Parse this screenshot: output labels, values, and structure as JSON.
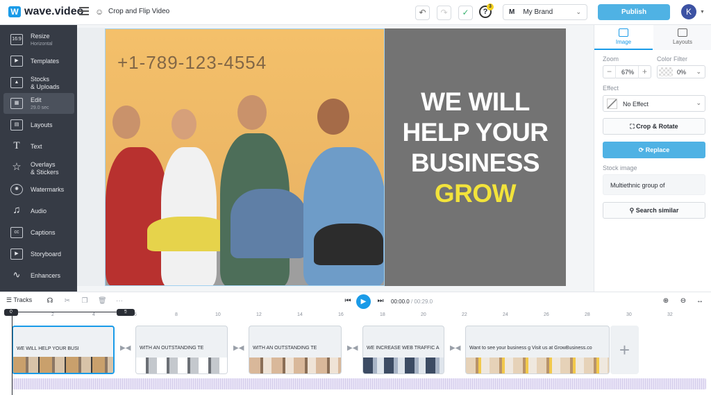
{
  "app": {
    "logo": "wave.video",
    "project_title": "Crop and Flip Video"
  },
  "header": {
    "help_badge": "3",
    "brand_initial": "M",
    "brand_name": "My Brand",
    "publish_label": "Publish",
    "avatar_initial": "K"
  },
  "sidebar": {
    "items": [
      {
        "label": "Resize",
        "sub": "Horizontal",
        "icon_text": "16:9"
      },
      {
        "label": "Templates"
      },
      {
        "label": "Stocks",
        "label2": "& Uploads"
      },
      {
        "label": "Edit",
        "sub": "29.0 sec"
      },
      {
        "label": "Layouts"
      },
      {
        "label": "Text"
      },
      {
        "label": "Overlays",
        "label2": "& Stickers"
      },
      {
        "label": "Watermarks"
      },
      {
        "label": "Audio"
      },
      {
        "label": "Captions"
      },
      {
        "label": "Storyboard"
      },
      {
        "label": "Enhancers"
      }
    ]
  },
  "canvas": {
    "phone_text": "+1-789-123-4554",
    "headline_lines": [
      "WE WILL",
      "HELP YOUR",
      "BUSINESS"
    ],
    "headline_accent": "GROW",
    "accent_color": "#f2e33b"
  },
  "right_panel": {
    "tab_image": "Image",
    "tab_layouts": "Layouts",
    "zoom_label": "Zoom",
    "zoom_value": "67%",
    "color_filter_label": "Color Filter",
    "color_filter_value": "0%",
    "effect_label": "Effect",
    "effect_value": "No Effect",
    "crop_rotate": "Crop & Rotate",
    "replace": "Replace",
    "stock_image_label": "Stock image",
    "stock_image_value": "Multiethnic group of",
    "search_similar": "Search similar"
  },
  "timeline": {
    "tracks_label": "Tracks",
    "current_time": "00:00.0",
    "total_time": "00:29.0",
    "ruler_ticks": [
      "2",
      "4",
      "6",
      "8",
      "10",
      "12",
      "14",
      "16",
      "18",
      "20",
      "22",
      "24",
      "26",
      "28",
      "30",
      "32"
    ],
    "start_marker": "0",
    "end_marker": "5",
    "clips": [
      {
        "text": "WE WILL  HELP YOUR BUSI"
      },
      {
        "text": "WITH AN OUTSTANDING TE"
      },
      {
        "text": "WITH AN OUTSTANDING TE"
      },
      {
        "text": "WE INCREASE  WEB TRAFFIC  A"
      },
      {
        "text": "Want to see your business g  Visit us at GrowBusiness.co"
      }
    ]
  }
}
